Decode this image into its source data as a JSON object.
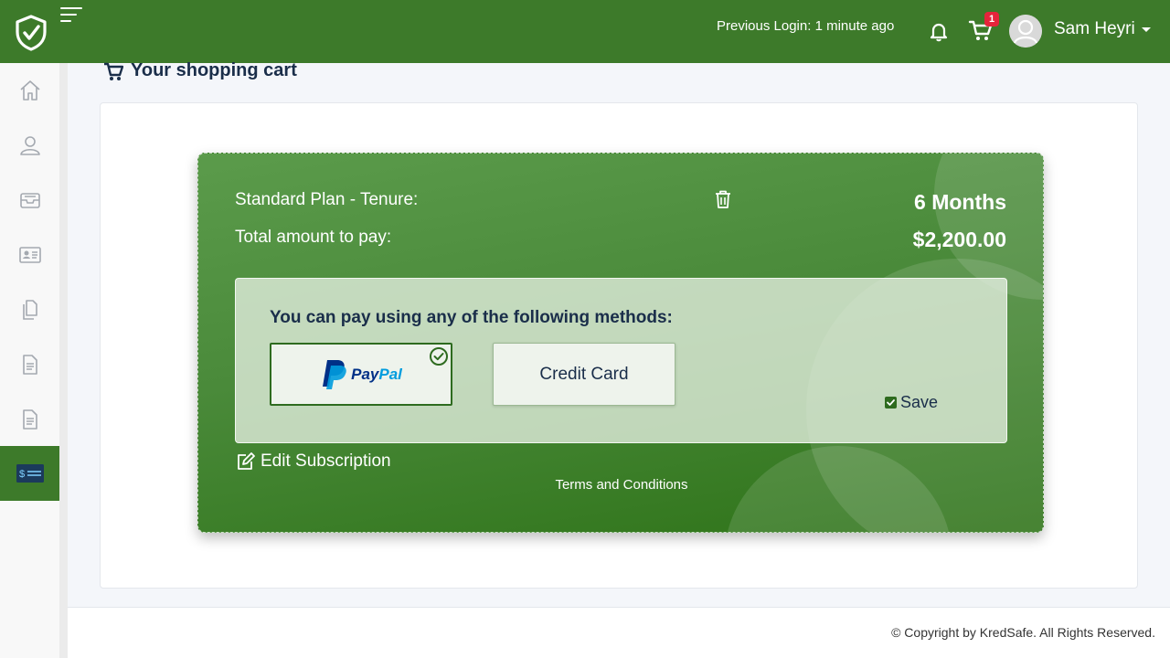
{
  "header": {
    "previous_login": "Previous Login: 1 minute ago",
    "cart_count": "1",
    "username": "Sam Heyri"
  },
  "sidebar": {
    "items": [
      {
        "icon": "home-icon"
      },
      {
        "icon": "user-icon"
      },
      {
        "icon": "inbox-icon"
      },
      {
        "icon": "id-card-icon"
      },
      {
        "icon": "documents-icon"
      },
      {
        "icon": "file-icon"
      },
      {
        "icon": "file-icon"
      },
      {
        "icon": "billing-icon",
        "active": true
      }
    ]
  },
  "page": {
    "title": "Your shopping cart"
  },
  "cart": {
    "plan_label": "Standard Plan - Tenure:",
    "plan_value": "6 Months",
    "total_label": "Total amount to pay:",
    "total_value": "$2,200.00",
    "payment_heading": "You can pay using any of the following methods:",
    "paypal_text_pay": "Pay",
    "paypal_text_pal": "Pal",
    "credit_card_label": "Credit Card",
    "save_label": "Save",
    "edit_label": "Edit Subscription",
    "terms_label": "Terms and Conditions"
  },
  "footer": {
    "copyright": "© Copyright by KredSafe. All Rights Reserved."
  },
  "colors": {
    "brand_green": "#3d7a2a",
    "navy_text": "#1a2e4a",
    "badge_red": "#e5243b",
    "paypal_dark": "#003087",
    "paypal_light": "#009cde"
  }
}
